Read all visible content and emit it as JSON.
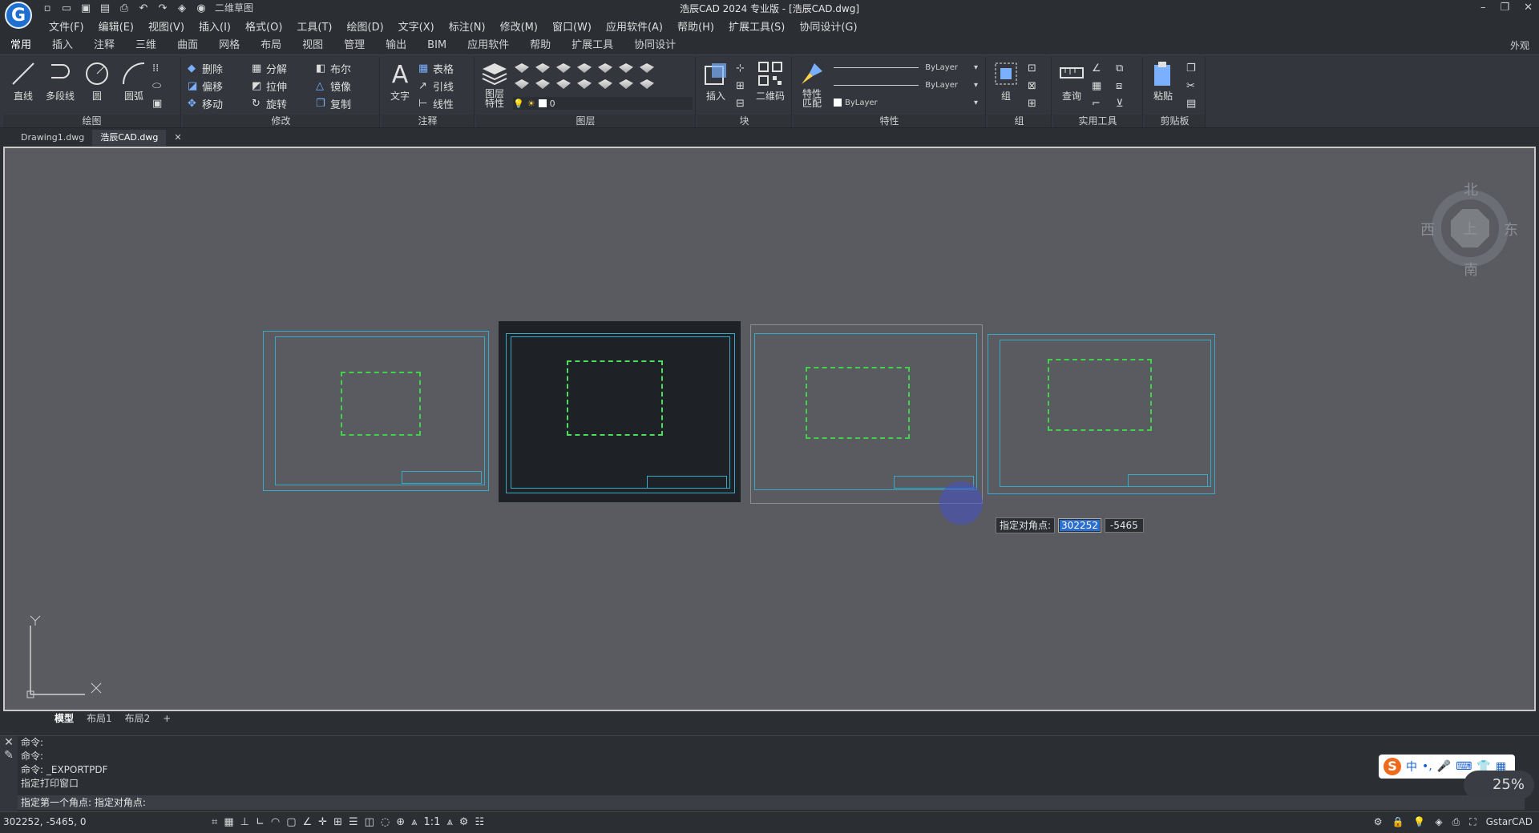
{
  "app": {
    "title": "浩辰CAD 2024 专业版 - [浩辰CAD.dwg]",
    "logo": "G",
    "workspace": "二维草图",
    "window_controls": [
      "–",
      "❐",
      "✕"
    ]
  },
  "menus": [
    "文件(F)",
    "编辑(E)",
    "视图(V)",
    "插入(I)",
    "格式(O)",
    "工具(T)",
    "绘图(D)",
    "文字(X)",
    "标注(N)",
    "修改(M)",
    "窗口(W)",
    "应用软件(A)",
    "帮助(H)",
    "扩展工具(S)",
    "协同设计(G)"
  ],
  "ribbon_tabs": [
    "常用",
    "插入",
    "注释",
    "三维",
    "曲面",
    "网格",
    "布局",
    "视图",
    "管理",
    "输出",
    "BIM",
    "应用软件",
    "帮助",
    "扩展工具",
    "协同设计"
  ],
  "ribbon_right": "外观",
  "panels": {
    "draw": {
      "label": "绘图",
      "line": "直线",
      "polyline": "多段线",
      "circle": "圆",
      "arc": "圆弧"
    },
    "modify": {
      "label": "修改",
      "items": [
        "删除",
        "分解",
        "布尔",
        "偏移",
        "拉伸",
        "镜像",
        "移动",
        "旋转",
        "复制"
      ]
    },
    "annotate": {
      "label": "注释",
      "text": "文字",
      "table": "表格",
      "leader": "引线",
      "linear": "线性"
    },
    "layers": {
      "label": "图层",
      "properties": "图层\n特性",
      "current_layer": "0"
    },
    "block": {
      "label": "块",
      "insert": "插入",
      "qrcode": "二维码"
    },
    "properties": {
      "label": "特性",
      "match": "特性\n匹配",
      "bylayer1": "ByLayer",
      "bylayer2": "ByLayer",
      "bylayer3": "ByLayer"
    },
    "group": {
      "label": "组",
      "group": "组"
    },
    "utilities": {
      "label": "实用工具",
      "query": "查询"
    },
    "clipboard": {
      "label": "剪贴板",
      "paste": "粘贴"
    }
  },
  "doc_tabs": [
    "Drawing1.dwg",
    "浩辰CAD.dwg"
  ],
  "compass": {
    "north": "北",
    "south": "南",
    "east": "东",
    "west": "西",
    "top": "上"
  },
  "dynamic_input": {
    "prompt": "指定对角点:",
    "x": "302252",
    "y": "-5465"
  },
  "ucs": {
    "x": "X",
    "y": "Y"
  },
  "layout_tabs": [
    "模型",
    "布局1",
    "布局2",
    "+"
  ],
  "command_history": [
    "命令:",
    "命令:",
    "命令: _EXPORTPDF",
    "指定打印窗口"
  ],
  "command_prompt": "指定第一个角点: 指定对角点:",
  "ime": {
    "lang": "中",
    "items": [
      "•,",
      "🎤",
      "⌨",
      "👕",
      "▦"
    ]
  },
  "zoom": "25%",
  "status": {
    "coords": "302252, -5465, 0",
    "scale": "1:1",
    "brand": "GstarCAD"
  },
  "colors": {
    "canvas": "#595b61",
    "sheet_border": "#39a9c8",
    "plan": "#3fd34a",
    "selected_bg": "#1e2227"
  }
}
